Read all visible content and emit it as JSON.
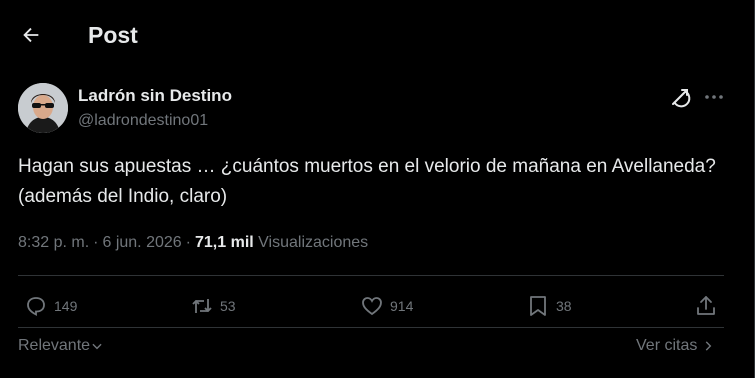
{
  "header": {
    "title": "Post"
  },
  "author": {
    "display_name": "Ladrón sin Destino",
    "handle": "@ladrondestino01"
  },
  "tweet": {
    "text": "Hagan sus apuestas … ¿cuántos muertos en el velorio de mañana en Avellaneda? (además del Indio, claro)",
    "time": "8:32 p. m.",
    "date": "6 jun. 2026",
    "separator": "·",
    "views_count": "71,1 mil",
    "views_label": "Visualizaciones"
  },
  "actions": {
    "replies": "149",
    "reposts": "53",
    "likes": "914",
    "bookmarks": "38"
  },
  "footer": {
    "sort_label": "Relevante",
    "quotes_label": "Ver citas"
  },
  "icons": {
    "back": "arrow-left-icon",
    "grok": "grok-icon",
    "more": "more-icon",
    "reply": "reply-icon",
    "repost": "repost-icon",
    "like": "heart-icon",
    "bookmark": "bookmark-icon",
    "share": "share-icon"
  },
  "colors": {
    "background": "#000000",
    "text": "#e7e9ea",
    "muted": "#71767b",
    "border": "#2f3336"
  }
}
